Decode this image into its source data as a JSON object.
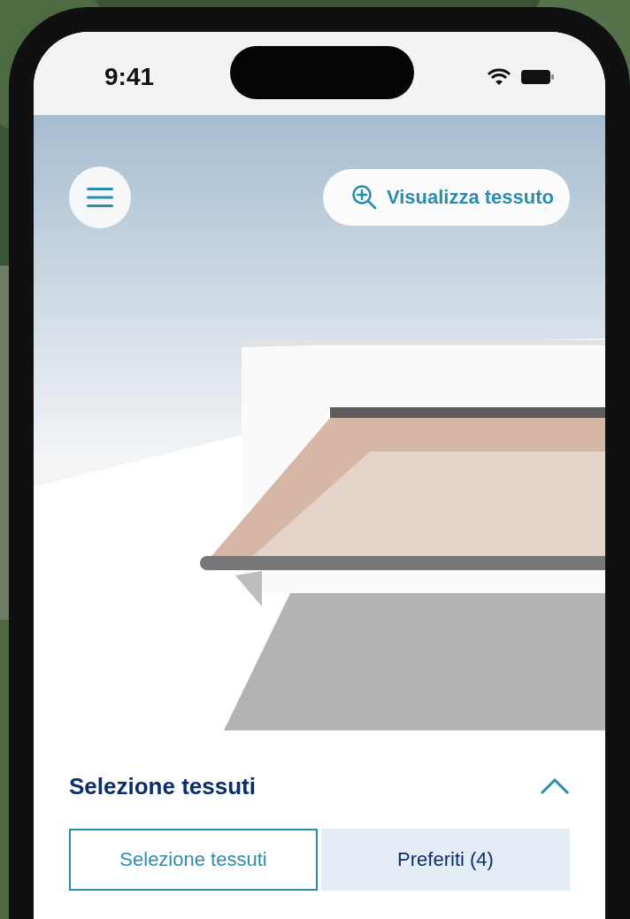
{
  "status_bar": {
    "time": "9:41"
  },
  "scene": {
    "view_fabric_button": {
      "label": "Visualizza tessuto"
    }
  },
  "panel": {
    "title": "Selezione tessuti",
    "expanded": true,
    "tabs": [
      {
        "label": "Selezione tessuti",
        "selected": true
      },
      {
        "label": "Preferiti (4)",
        "selected": false
      }
    ]
  }
}
